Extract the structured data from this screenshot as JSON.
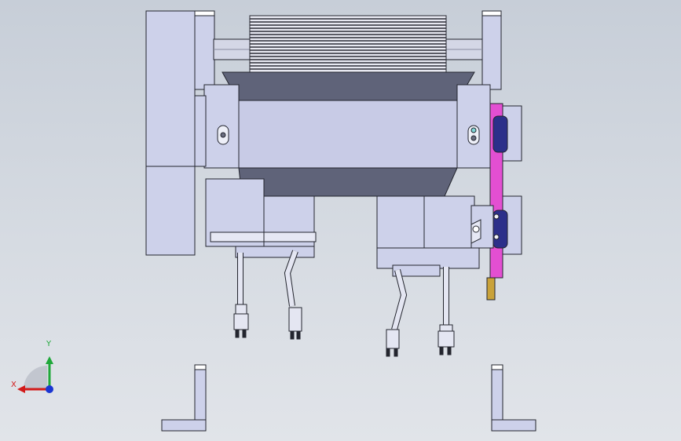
{
  "viewport": {
    "background_top": "#c7ced8",
    "background_bottom": "#e1e4e9"
  },
  "triad": {
    "x_label": "X",
    "y_label": "Y",
    "x_color": "#d21a1a",
    "y_color": "#1fa83a",
    "z_color": "#1a36d2"
  },
  "colors": {
    "body": "#cdd1ea",
    "body_dark": "#5f6379",
    "edge": "#23252e",
    "accent_plate": "#e34fd2",
    "pulley": "#2c2f8a"
  }
}
